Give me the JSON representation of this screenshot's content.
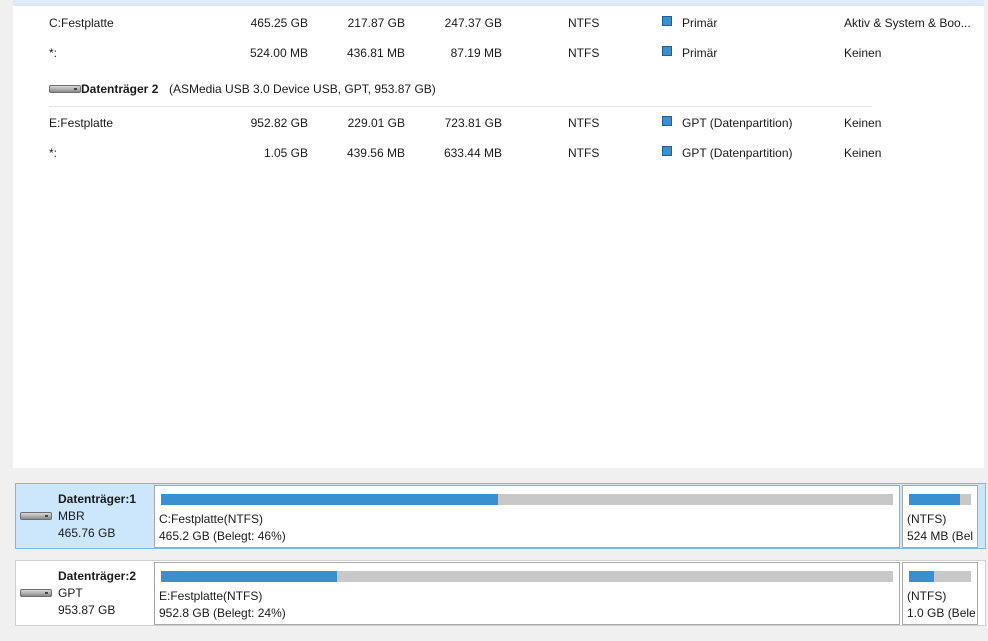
{
  "partition_list": {
    "rows_disk1": [
      {
        "name": "C:Festplatte",
        "capacity": "465.25 GB",
        "used": "217.87 GB",
        "free": "247.37 GB",
        "fs": "NTFS",
        "type": "Primär",
        "status": "Aktiv & System & Boo..."
      },
      {
        "name": "*:",
        "capacity": "524.00 MB",
        "used": "436.81 MB",
        "free": "87.19 MB",
        "fs": "NTFS",
        "type": "Primär",
        "status": "Keinen"
      }
    ],
    "disk2_header": {
      "name": "Datenträger 2",
      "info": "(ASMedia USB 3.0 Device USB, GPT, 953.87 GB)"
    },
    "rows_disk2": [
      {
        "name": "E:Festplatte",
        "capacity": "952.82 GB",
        "used": "229.01 GB",
        "free": "723.81 GB",
        "fs": "NTFS",
        "type": "GPT (Datenpartition)",
        "status": "Keinen"
      },
      {
        "name": "*:",
        "capacity": "1.05 GB",
        "used": "439.56 MB",
        "free": "633.44 MB",
        "fs": "NTFS",
        "type": "GPT (Datenpartition)",
        "status": "Keinen"
      }
    ]
  },
  "disk_map": [
    {
      "label": "Datenträger:1",
      "style": "MBR",
      "size": "465.76 GB",
      "selected": true,
      "partitions": [
        {
          "name": "C:Festplatte(NTFS)",
          "detail": "465.2 GB (Belegt: 46%)",
          "used_fraction": 0.46
        },
        {
          "name": "(NTFS)",
          "detail": "524 MB (Bel",
          "used_fraction": 0.83
        }
      ]
    },
    {
      "label": "Datenträger:2",
      "style": "GPT",
      "size": "953.87 GB",
      "selected": false,
      "partitions": [
        {
          "name": "E:Festplatte(NTFS)",
          "detail": "952.8 GB (Belegt: 24%)",
          "used_fraction": 0.24
        },
        {
          "name": "(NTFS)",
          "detail": "1.0 GB (Bele",
          "used_fraction": 0.41
        }
      ]
    }
  ],
  "colors": {
    "accent": "#3a8fd0",
    "selected_bg": "#cce6fb",
    "bar_empty": "#c8c8c8"
  },
  "icons": {
    "disk": "hard-drive-icon",
    "partition_type": "square-icon"
  }
}
